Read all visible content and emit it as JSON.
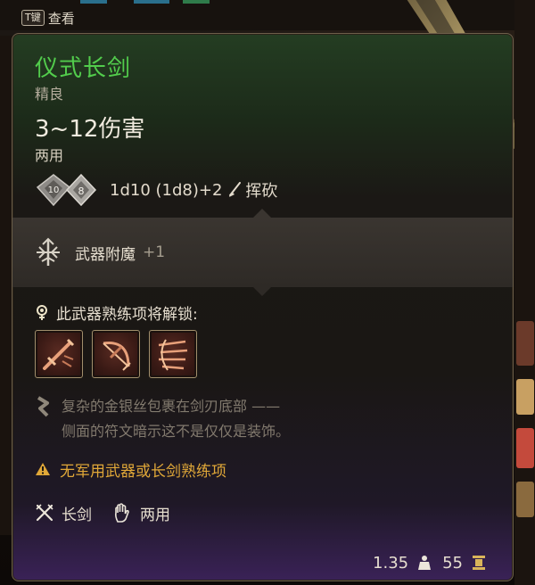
{
  "hud": {
    "hotkey_key": "T键",
    "hotkey_label": "查看"
  },
  "item": {
    "name": "仪式长剑",
    "rarity": "精良",
    "damage": "3~12伤害",
    "handedness": "两用",
    "dice": {
      "die_a": "10",
      "die_b": "8",
      "formula": "1d10 (1d8)+2",
      "damage_type": "挥砍"
    },
    "enchant": {
      "label": "武器附魔",
      "bonus": "+1"
    },
    "proficiency_unlock_label": "此武器熟练项将解锁:",
    "actions": [
      {
        "icon": "sword-strike-action-icon"
      },
      {
        "icon": "crossbow-shot-action-icon"
      },
      {
        "icon": "flurry-action-icon"
      }
    ],
    "lore_line1": "复杂的金银丝包裹在剑刃底部 ——",
    "lore_line2": "侧面的符文暗示这不是仅仅是装饰。",
    "warning": "无军用武器或长剑熟练项",
    "tags": [
      {
        "icon": "crossed-swords-icon",
        "label": "长剑"
      },
      {
        "icon": "hand-icon",
        "label": "两用"
      }
    ],
    "weight": "1.35",
    "value": "55"
  },
  "colors": {
    "name_green": "#52cc4c",
    "warning_amber": "#e1a838",
    "lore_gray": "#827a6e"
  }
}
